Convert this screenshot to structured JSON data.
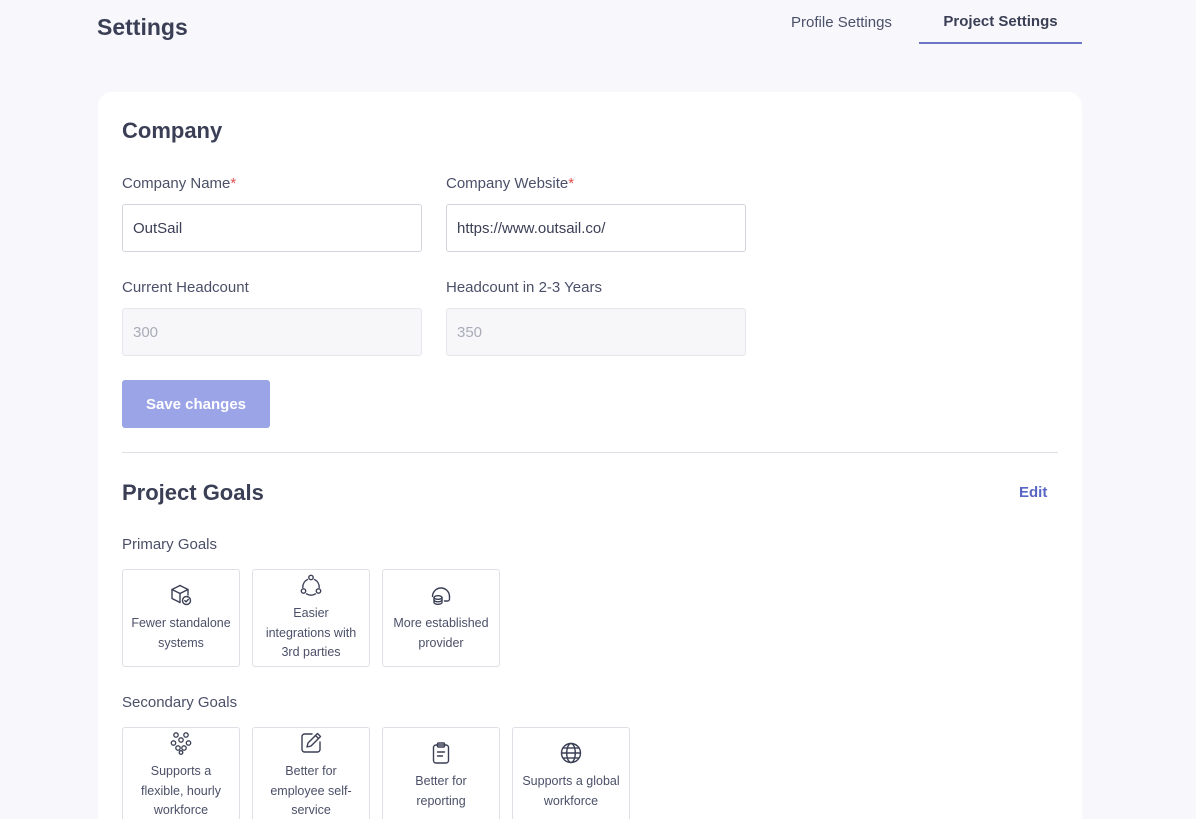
{
  "header": {
    "title": "Settings",
    "tabs": [
      {
        "label": "Profile Settings",
        "active": false
      },
      {
        "label": "Project Settings",
        "active": true
      }
    ]
  },
  "company": {
    "section_title": "Company",
    "name_label": "Company Name",
    "name_value": "OutSail",
    "website_label": "Company Website",
    "website_value": "https://www.outsail.co/",
    "required_mark": "*",
    "current_headcount_label": "Current Headcount",
    "current_headcount_value": "300",
    "future_headcount_label": "Headcount in 2-3 Years",
    "future_headcount_value": "350",
    "save_label": "Save changes"
  },
  "goals": {
    "section_title": "Project Goals",
    "edit_label": "Edit",
    "primary_label": "Primary Goals",
    "primary": [
      {
        "label": "Fewer standalone systems",
        "icon": "cube-check-icon"
      },
      {
        "label": "Easier integrations with 3rd parties",
        "icon": "integration-nodes-icon"
      },
      {
        "label": "More established provider",
        "icon": "database-badge-icon"
      }
    ],
    "secondary_label": "Secondary Goals",
    "secondary": [
      {
        "label": "Supports a flexible, hourly workforce",
        "icon": "people-group-icon"
      },
      {
        "label": "Better for employee self-service",
        "icon": "edit-pen-icon"
      },
      {
        "label": "Better for reporting",
        "icon": "clipboard-icon"
      },
      {
        "label": "Supports a global workforce",
        "icon": "globe-icon"
      }
    ]
  },
  "colors": {
    "accent": "#6b76c9",
    "button": "#9ba4e6",
    "required": "#e05050",
    "background": "#f8f8fc"
  }
}
